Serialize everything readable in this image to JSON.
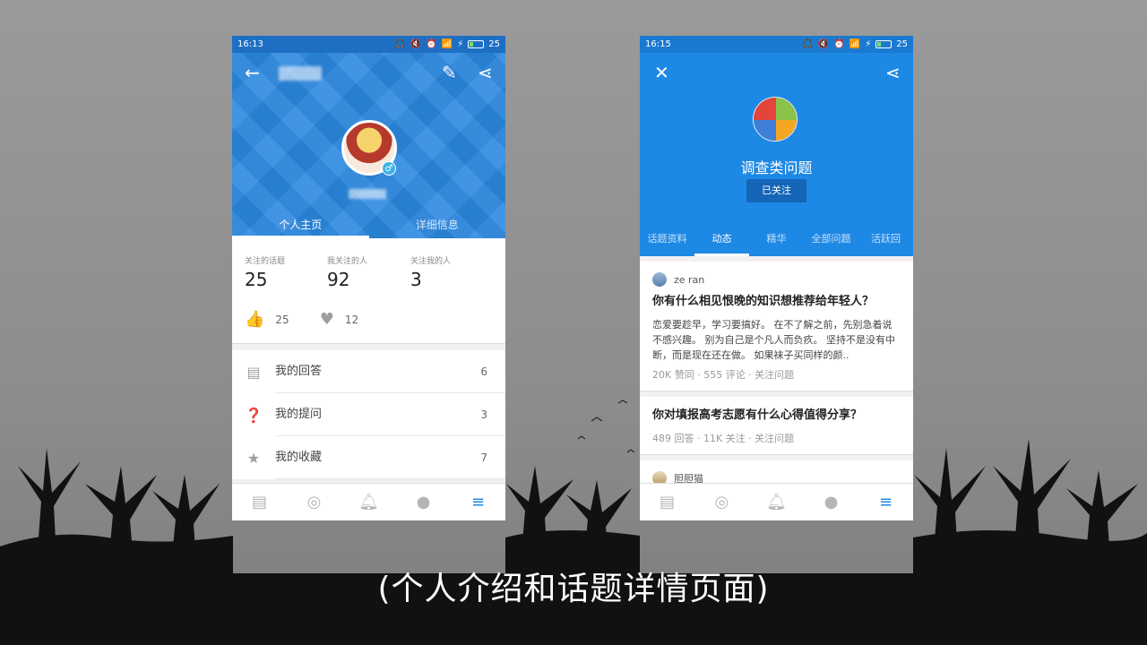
{
  "caption": "(个人介绍和话题详情页面)",
  "left_phone": {
    "status": {
      "time": "16:13",
      "battery": "25"
    },
    "tabs": [
      {
        "label": "个人主页",
        "active": true
      },
      {
        "label": "详细信息",
        "active": false
      }
    ],
    "stats": [
      {
        "label": "关注的话题",
        "value": "25"
      },
      {
        "label": "我关注的人",
        "value": "92"
      },
      {
        "label": "关注我的人",
        "value": "3"
      }
    ],
    "likes": {
      "agree": "25",
      "thanks": "12"
    },
    "menu": [
      {
        "icon": "answer-icon",
        "label": "我的回答",
        "count": "6"
      },
      {
        "icon": "question-icon",
        "label": "我的提问",
        "count": "3"
      },
      {
        "icon": "star-icon",
        "label": "我的收藏",
        "count": "7"
      }
    ],
    "accent": "#2b88e0"
  },
  "right_phone": {
    "status": {
      "time": "16:15",
      "battery": "25"
    },
    "topic_title": "调查类问题",
    "follow_label": "已关注",
    "tabs": [
      {
        "label": "话题资料",
        "active": false
      },
      {
        "label": "动态",
        "active": true
      },
      {
        "label": "精华",
        "active": false
      },
      {
        "label": "全部问题",
        "active": false
      },
      {
        "label": "活跃回",
        "active": false
      }
    ],
    "feed": [
      {
        "author": "ze ran",
        "title": "你有什么相见恨晚的知识想推荐给年轻人？",
        "body": "恋爱要趁早，学习要搞好。 在不了解之前，先别急着说不感兴趣。 别为自己是个凡人而负疚。 坚持不是没有中断，而是现在还在做。 如果袜子买同样的颜..",
        "meta": "20K 赞同 · 555 评论 · 关注问题"
      },
      {
        "title": "你对填报高考志愿有什么心得值得分享？",
        "meta": "489 回答 · 11K 关注 · 关注问题"
      },
      {
        "author": "胆胆猫"
      }
    ],
    "accent": "#1e88e5"
  }
}
